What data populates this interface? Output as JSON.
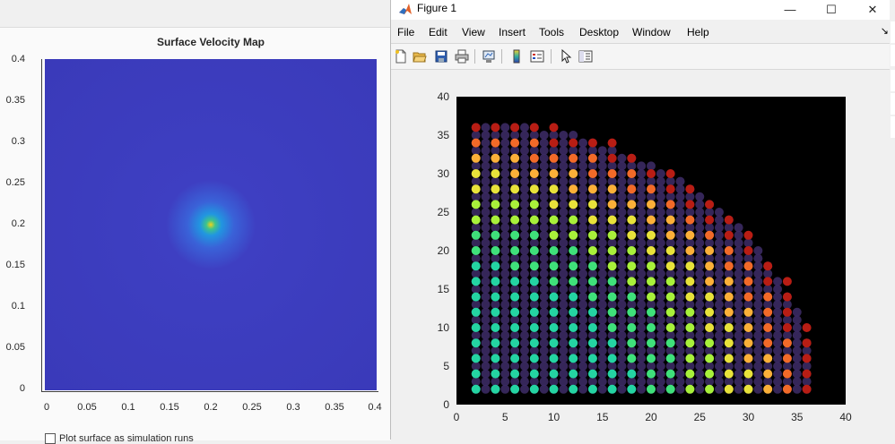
{
  "left_app": {
    "title": "Surface Velocity Map",
    "y_ticks": [
      "0.4",
      "0.35",
      "0.3",
      "0.25",
      "0.2",
      "0.15",
      "0.1",
      "0.05",
      "0"
    ],
    "x_ticks": [
      "0",
      "0.05",
      "0.1",
      "0.15",
      "0.2",
      "0.25",
      "0.3",
      "0.35",
      "0.4"
    ],
    "checkbox_label": "Plot surface as simulation runs"
  },
  "window": {
    "title": "Figure 1",
    "minimize": "—",
    "maximize": "☐",
    "close": "✕"
  },
  "menu": [
    "File",
    "Edit",
    "View",
    "Insert",
    "Tools",
    "Desktop",
    "Window",
    "Help"
  ],
  "menu_arrow": "↘",
  "toolbar": [
    "new-figure-icon",
    "open-file-icon",
    "save-icon",
    "print-icon",
    "link-plot-icon",
    "colorbar-icon",
    "legend-icon",
    "pointer-icon",
    "property-editor-icon"
  ],
  "colors": {
    "plot_background": "#000000",
    "window_background": "#f0f0f0",
    "marker_dark": "#3b2a63"
  },
  "chart_data": {
    "type": "scatter",
    "title": "",
    "xlabel": "",
    "ylabel": "",
    "xlim": [
      0,
      40
    ],
    "ylim": [
      0,
      40
    ],
    "x_ticks": [
      0,
      5,
      10,
      15,
      20,
      25,
      30,
      35,
      40
    ],
    "y_ticks": [
      0,
      5,
      10,
      15,
      20,
      25,
      30,
      35,
      40
    ],
    "background": "#000000",
    "grid_spacing": 1,
    "region": "quarter-disc",
    "region_radius": 37,
    "marker_colors": [
      "#24d4a2",
      "#3fe07a",
      "#a8f03a",
      "#e8e23a",
      "#fbb038",
      "#f26a28",
      "#b81d14"
    ]
  }
}
